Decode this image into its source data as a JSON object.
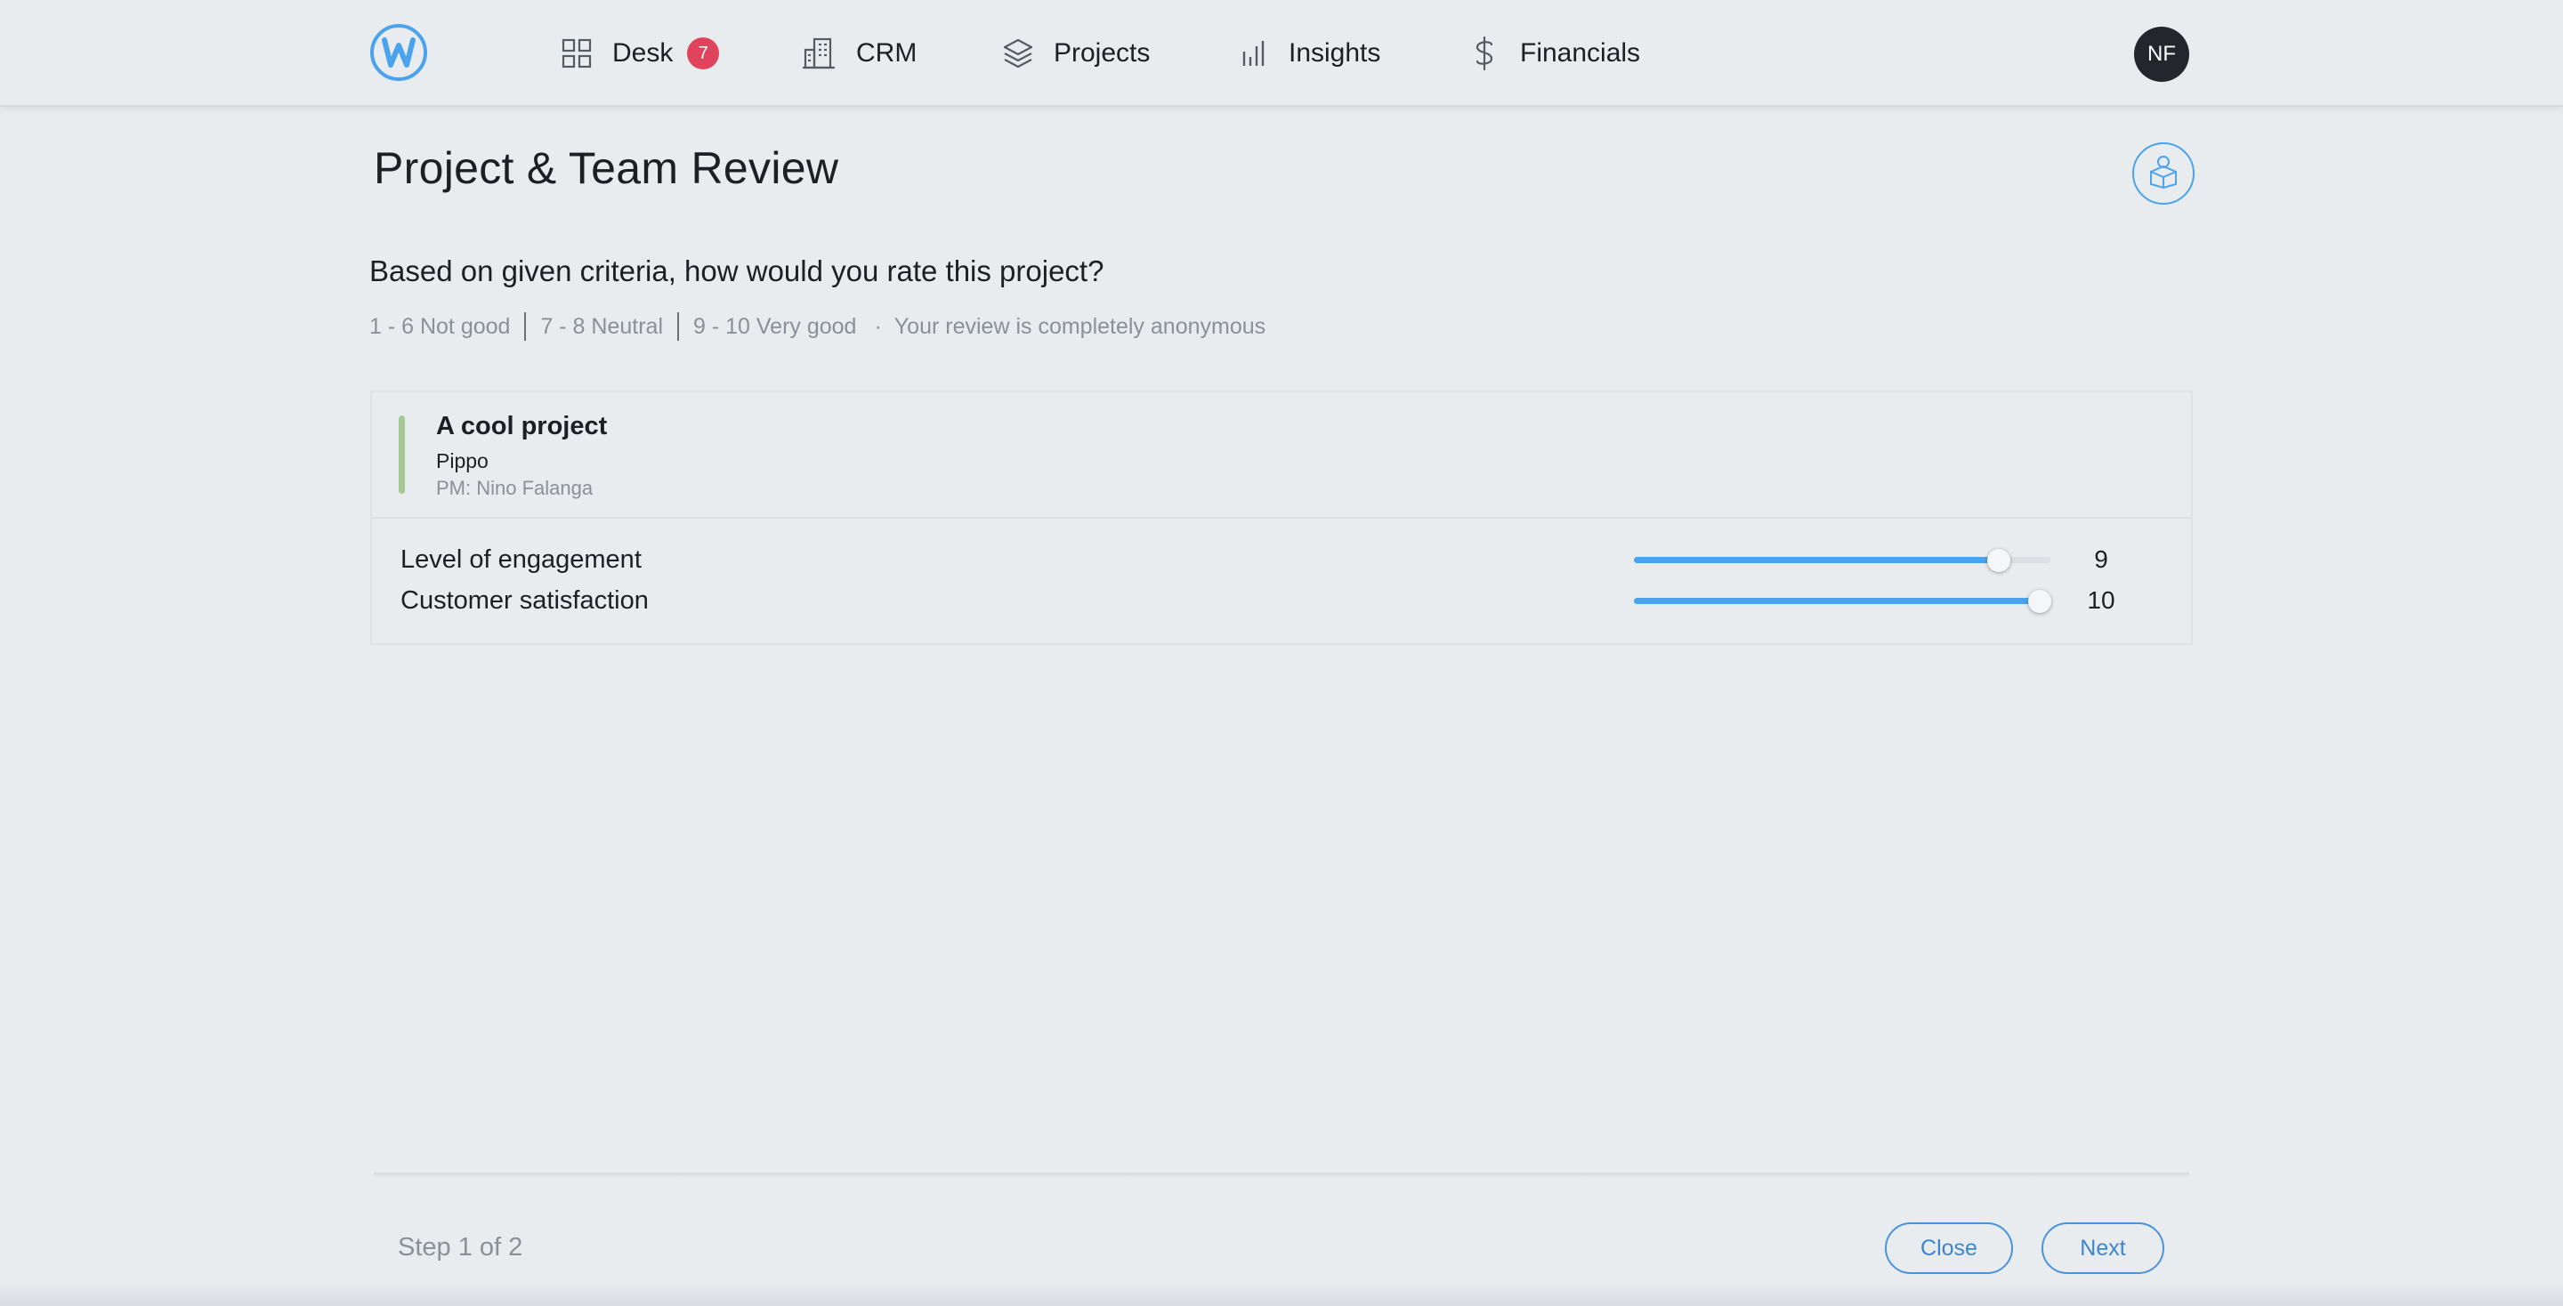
{
  "nav": {
    "logo_letter": "W",
    "items": [
      {
        "label": "Desk",
        "icon": "grid-icon",
        "badge": "7"
      },
      {
        "label": "CRM",
        "icon": "building-icon"
      },
      {
        "label": "Projects",
        "icon": "layers-icon"
      },
      {
        "label": "Insights",
        "icon": "bar-chart-icon"
      },
      {
        "label": "Financials",
        "icon": "dollar-icon"
      }
    ],
    "avatar_initials": "NF"
  },
  "page": {
    "title": "Project & Team Review",
    "help_icon": "help-desk-icon",
    "question": "Based on given criteria, how would you rate this project?",
    "legend": {
      "not_good": "1 - 6 Not good",
      "neutral": "7 - 8 Neutral",
      "very_good": "9 - 10 Very good",
      "dot": "·",
      "anonymous": "Your review is completely anonymous"
    }
  },
  "project": {
    "name": "A cool project",
    "client": "Pippo",
    "pm": "PM: Nino Falanga",
    "accent_color": "#a6c894",
    "criteria": [
      {
        "label": "Level of engagement",
        "value": "9",
        "fraction": 0.875
      },
      {
        "label": "Customer satisfaction",
        "value": "10",
        "fraction": 0.975
      }
    ]
  },
  "footer": {
    "step": "Step 1 of 2",
    "close_label": "Close",
    "next_label": "Next"
  },
  "colors": {
    "accent": "#4aa3ec",
    "badge": "#e0445d",
    "background": "#e9ecef"
  }
}
